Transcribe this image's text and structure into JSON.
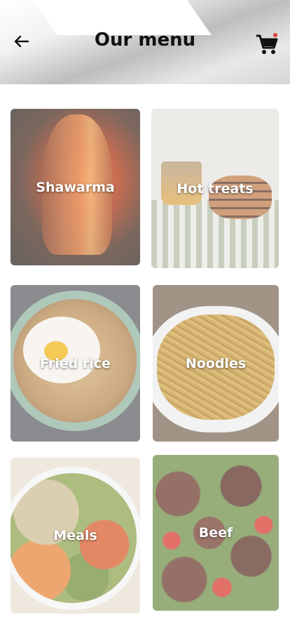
{
  "header": {
    "title": "Our menu",
    "back_icon": "arrow-left-icon",
    "cart_icon": "shopping-cart-icon",
    "cart_badge_color": "#e53935"
  },
  "menu": {
    "items": [
      {
        "label": "Shawarma"
      },
      {
        "label": "Hot treats"
      },
      {
        "label": "Fried rice"
      },
      {
        "label": "Noodles"
      },
      {
        "label": "Meals"
      },
      {
        "label": "Beef"
      }
    ]
  }
}
